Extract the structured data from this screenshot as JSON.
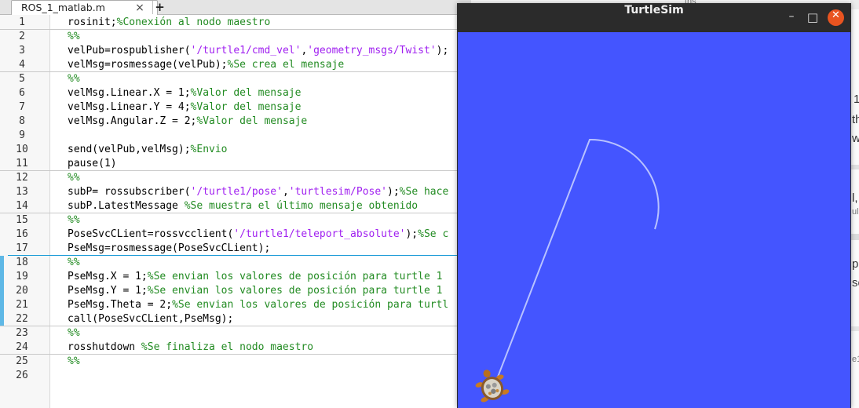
{
  "editor": {
    "tab_label": "ROS_1_matlab.m",
    "tab_close": "×",
    "tab_add": "+",
    "lines": [
      {
        "n": "1",
        "parts": [
          [
            "n",
            "rosinit;"
          ],
          [
            "c",
            "%Conexión al nodo maestro"
          ]
        ]
      },
      {
        "n": "2",
        "parts": [
          [
            "c",
            "%%"
          ]
        ]
      },
      {
        "n": "3",
        "parts": [
          [
            "n",
            "velPub=rospublisher("
          ],
          [
            "s",
            "'/turtle1/cmd_vel'"
          ],
          [
            "n",
            ","
          ],
          [
            "s",
            "'geometry_msgs/Twist'"
          ],
          [
            "n",
            ");"
          ]
        ]
      },
      {
        "n": "4",
        "parts": [
          [
            "n",
            "velMsg=rosmessage(velPub);"
          ],
          [
            "c",
            "%Se crea el mensaje"
          ]
        ]
      },
      {
        "n": "5",
        "parts": [
          [
            "c",
            "%%"
          ]
        ]
      },
      {
        "n": "6",
        "parts": [
          [
            "n",
            "velMsg.Linear.X = 1;"
          ],
          [
            "c",
            "%Valor del mensaje"
          ]
        ]
      },
      {
        "n": "7",
        "parts": [
          [
            "n",
            "velMsg.Linear.Y = 4;"
          ],
          [
            "c",
            "%Valor del mensaje"
          ]
        ]
      },
      {
        "n": "8",
        "parts": [
          [
            "n",
            "velMsg.Angular.Z = 2;"
          ],
          [
            "c",
            "%Valor del mensaje"
          ]
        ]
      },
      {
        "n": "9",
        "parts": []
      },
      {
        "n": "10",
        "parts": [
          [
            "n",
            "send(velPub,velMsg);"
          ],
          [
            "c",
            "%Envio"
          ]
        ]
      },
      {
        "n": "11",
        "parts": [
          [
            "n",
            "pause(1)"
          ]
        ]
      },
      {
        "n": "12",
        "parts": [
          [
            "c",
            "%%"
          ]
        ]
      },
      {
        "n": "13",
        "parts": [
          [
            "n",
            "subP= rossubscriber("
          ],
          [
            "s",
            "'/turtle1/pose'"
          ],
          [
            "n",
            ","
          ],
          [
            "s",
            "'turtlesim/Pose'"
          ],
          [
            "n",
            ");"
          ],
          [
            "c",
            "%Se hace"
          ]
        ]
      },
      {
        "n": "14",
        "parts": [
          [
            "n",
            "subP.LatestMessage "
          ],
          [
            "c",
            "%Se muestra el último mensaje obtenido"
          ]
        ]
      },
      {
        "n": "15",
        "parts": [
          [
            "c",
            "%%"
          ]
        ]
      },
      {
        "n": "16",
        "parts": [
          [
            "n",
            "PoseSvcCLient=rossvcclient("
          ],
          [
            "s",
            "'/turtle1/teleport_absolute'"
          ],
          [
            "n",
            ");"
          ],
          [
            "c",
            "%Se c"
          ]
        ]
      },
      {
        "n": "17",
        "parts": [
          [
            "n",
            "PseMsg=rosmessage(PoseSvcCLient);"
          ]
        ]
      },
      {
        "n": "18",
        "parts": [
          [
            "c",
            "%%"
          ]
        ]
      },
      {
        "n": "19",
        "parts": [
          [
            "n",
            "PseMsg.X = 1;"
          ],
          [
            "c",
            "%Se envian los valores de posición para turtle 1"
          ]
        ]
      },
      {
        "n": "20",
        "parts": [
          [
            "n",
            "PseMsg.Y = 1;"
          ],
          [
            "c",
            "%Se envian los valores de posición para turtle 1"
          ]
        ]
      },
      {
        "n": "21",
        "parts": [
          [
            "n",
            "PseMsg.Theta = 2;"
          ],
          [
            "c",
            "%Se envian los valores de posición para turtl"
          ]
        ]
      },
      {
        "n": "22",
        "parts": [
          [
            "n",
            "call(PoseSvcCLient,PseMsg);"
          ]
        ]
      },
      {
        "n": "23",
        "parts": [
          [
            "c",
            "%%"
          ]
        ]
      },
      {
        "n": "24",
        "parts": [
          [
            "n",
            "rosshutdown "
          ],
          [
            "c",
            "%Se finaliza el nodo maestro"
          ]
        ]
      },
      {
        "n": "25",
        "parts": [
          [
            "c",
            "%%"
          ]
        ]
      },
      {
        "n": "26",
        "parts": []
      }
    ],
    "colors": {
      "string": "#a020f0",
      "comment": "#228b22",
      "code": "#000000",
      "active_cell": "#1a9bd7"
    }
  },
  "background_window": {
    "fragments": [
      "ths",
      "1 v",
      "th",
      "w",
      "l,",
      "ul",
      "p",
      "se",
      "e1"
    ]
  },
  "turtlesim": {
    "title": "TurtleSim",
    "minimize": "–",
    "maximize": "□",
    "close": "✕",
    "background_color": "#4455ff",
    "trail_color": "#b8c2ff"
  }
}
